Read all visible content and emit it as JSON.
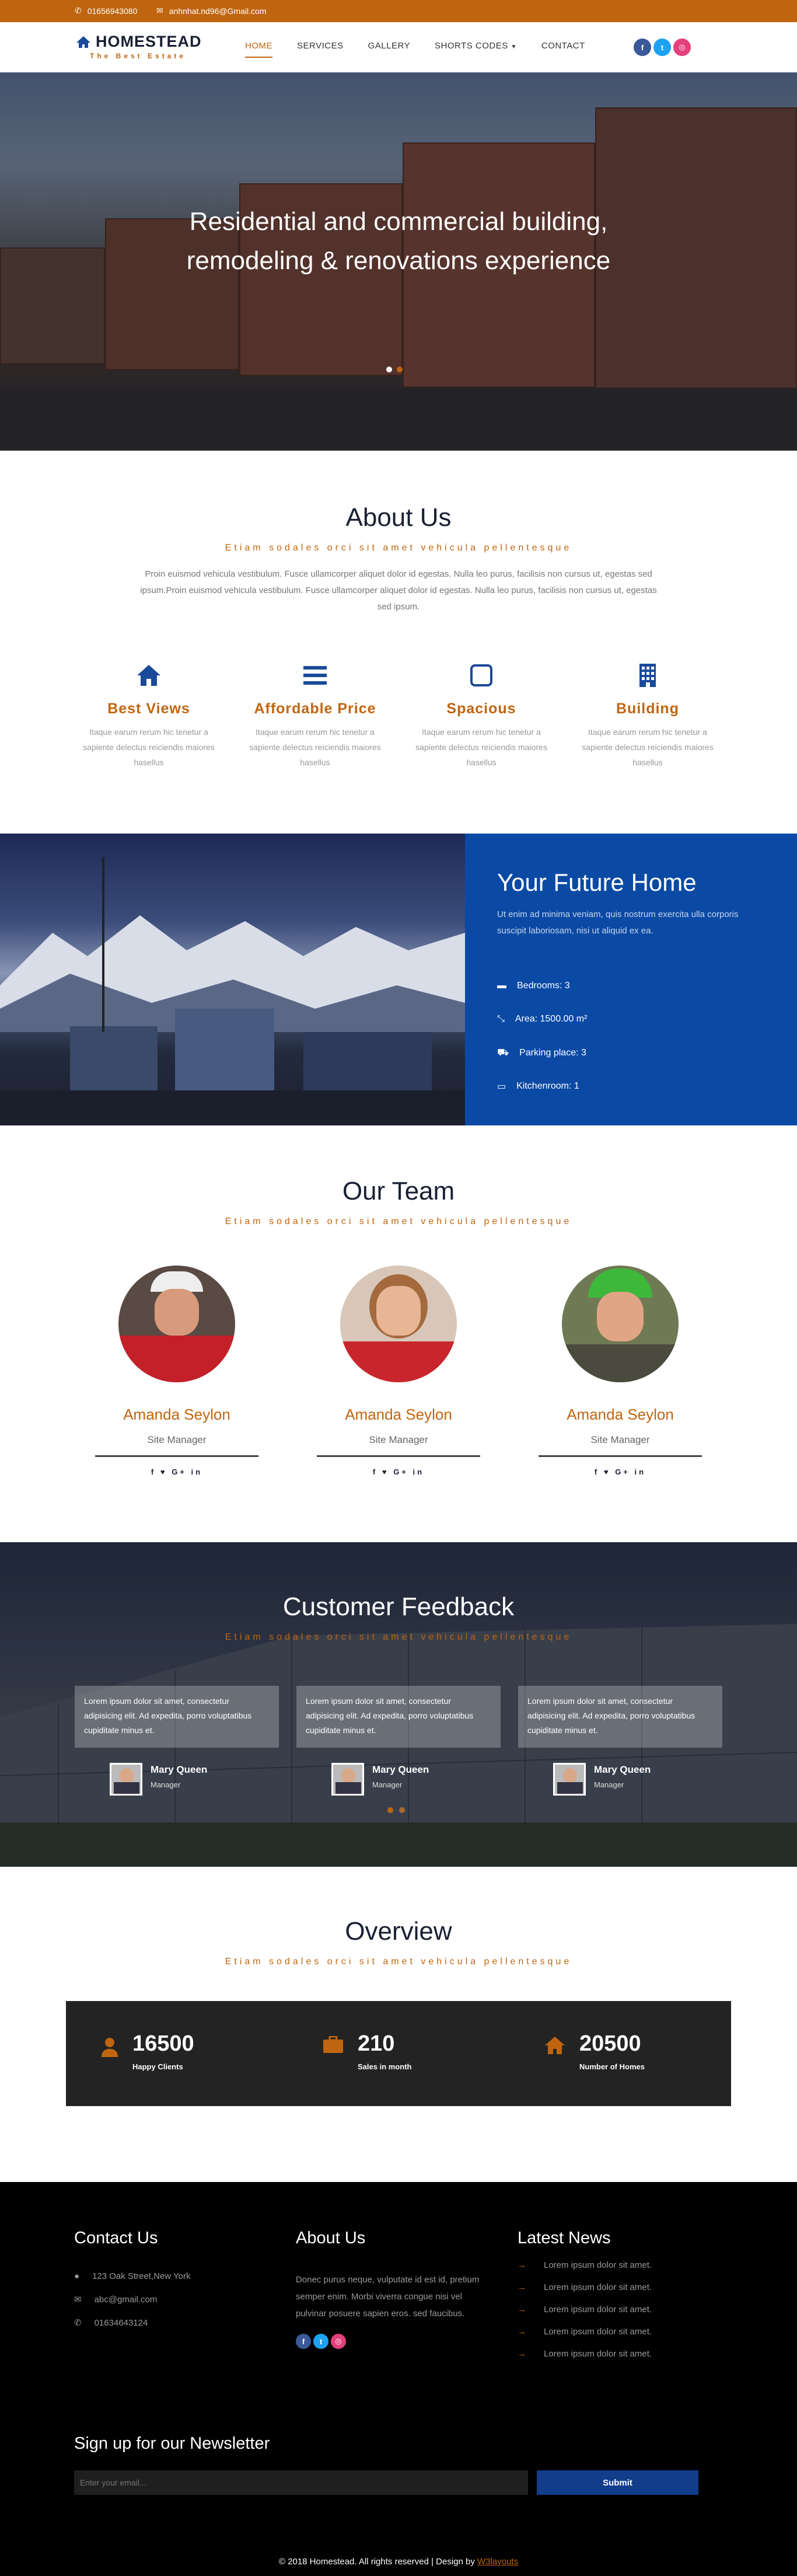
{
  "topbar": {
    "phone": "01656943080",
    "email": "anhnhat.nd96@Gmail.com"
  },
  "brand": {
    "name": "HOMESTEAD",
    "tagline": "The Best Estate"
  },
  "nav": {
    "items": [
      {
        "label": "HOME",
        "active": true
      },
      {
        "label": "SERVICES"
      },
      {
        "label": "GALLERY"
      },
      {
        "label": "SHORTS CODES"
      },
      {
        "label": "CONTACT"
      }
    ]
  },
  "social": [
    {
      "name": "facebook-icon",
      "glyph": "f",
      "color": "#3b5998"
    },
    {
      "name": "twitter-icon",
      "glyph": "t",
      "color": "#1da1f2"
    },
    {
      "name": "dribbble-icon",
      "glyph": "◎",
      "color": "#e4407b"
    }
  ],
  "hero": {
    "line1": "Residential and commercial building,",
    "line2": "remodeling & renovations experience"
  },
  "about": {
    "title": "About Us",
    "subtitle": "Etiam sodales orci sit amet vehicula pellentesque",
    "text": "Proin euismod vehicula vestibulum. Fusce ullamcorper aliquet dolor id egestas. Nulla leo purus, facilisis non cursus ut, egestas sed ipsum.Proin euismod vehicula vestibulum. Fusce ullamcorper aliquet dolor id egestas. Nulla leo purus, facilisis non cursus ut, egestas sed ipsum.",
    "features": [
      {
        "title": "Best Views",
        "icon": "home-icon",
        "text": "Itaque earum rerum hic tenetur a sapiente delectus reiciendis maiores hasellus"
      },
      {
        "title": "Affordable Price",
        "icon": "menu-lines-icon",
        "text": "Itaque earum rerum hic tenetur a sapiente delectus reiciendis maiores hasellus"
      },
      {
        "title": "Spacious",
        "icon": "square-icon",
        "text": "Itaque earum rerum hic tenetur a sapiente delectus reiciendis maiores hasellus"
      },
      {
        "title": "Building",
        "icon": "building-icon",
        "text": "Itaque earum rerum hic tenetur a sapiente delectus reiciendis maiores hasellus"
      }
    ]
  },
  "future": {
    "title": "Your Future Home",
    "intro": "Ut enim ad minima veniam, quis nostrum exercita ulla corporis suscipit laboriosam, nisi ut aliquid ex ea.",
    "rows": [
      {
        "icon": "bed-icon",
        "label": "Bedrooms: 3"
      },
      {
        "icon": "area-icon",
        "label": "Area: 1500.00 m²"
      },
      {
        "icon": "car-icon",
        "label": "Parking place: 3"
      },
      {
        "icon": "kitchen-icon",
        "label": "Kitchenroom: 1"
      }
    ]
  },
  "team": {
    "title": "Our Team",
    "subtitle": "Etiam sodales orci sit amet vehicula pellentesque",
    "members": [
      {
        "name": "Amanda Seylon",
        "role": "Site Manager",
        "social": "f  ♥  G+  in"
      },
      {
        "name": "Amanda Seylon",
        "role": "Site Manager",
        "social": "f  ♥  G+  in"
      },
      {
        "name": "Amanda Seylon",
        "role": "Site Manager",
        "social": "f  ♥  G+  in"
      }
    ]
  },
  "feedback": {
    "title": "Customer Feedback",
    "subtitle": "Etiam sodales orci sit amet vehicula pellentesque",
    "cards": [
      {
        "text": "Lorem ipsum dolor sit amet, consectetur adipisicing elit. Ad expedita, porro voluptatibus cupiditate minus et.",
        "name": "Mary Queen",
        "role": "Manager"
      },
      {
        "text": "Lorem ipsum dolor sit amet, consectetur adipisicing elit. Ad expedita, porro voluptatibus cupiditate minus et.",
        "name": "Mary Queen",
        "role": "Manager"
      },
      {
        "text": "Lorem ipsum dolor sit amet, consectetur adipisicing elit. Ad expedita, porro voluptatibus cupiditate minus et.",
        "name": "Mary Queen",
        "role": "Manager"
      }
    ]
  },
  "overview": {
    "title": "Overview",
    "subtitle": "Etiam sodales orci sit amet vehicula pellentesque",
    "stats": [
      {
        "icon": "user-icon",
        "num": "16500",
        "label": "Happy Clients"
      },
      {
        "icon": "briefcase-icon",
        "num": "210",
        "label": "Sales in month"
      },
      {
        "icon": "home-icon",
        "num": "20500",
        "label": "Number of Homes"
      }
    ]
  },
  "footer": {
    "contact": {
      "title": "Contact Us",
      "address": "123 Oak Street,New York",
      "email": "abc@gmail.com",
      "phone": "01634643124"
    },
    "about": {
      "title": "About Us",
      "text": "Donec purus neque, vulputate id est id, pretium semper enim. Morbi viverra congue nisi vel pulvinar posuere sapien eros. sed faucibus."
    },
    "news": {
      "title": "Latest News",
      "items": [
        "Lorem ipsum dolor sit amet.",
        "Lorem ipsum dolor sit amet.",
        "Lorem ipsum dolor sit amet.",
        "Lorem ipsum dolor sit amet.",
        "Lorem ipsum dolor sit amet."
      ]
    },
    "newsletter": {
      "title": "Sign up for our Newsletter",
      "placeholder": "Enter your email...",
      "button": "Submit"
    },
    "copyright": "© 2018 Homestead. All rights reserved | Design by ",
    "designer": "W3layouts"
  },
  "colors": {
    "accent": "#c0650f",
    "navy": "#1a2033",
    "blue": "#0a4aa5"
  }
}
